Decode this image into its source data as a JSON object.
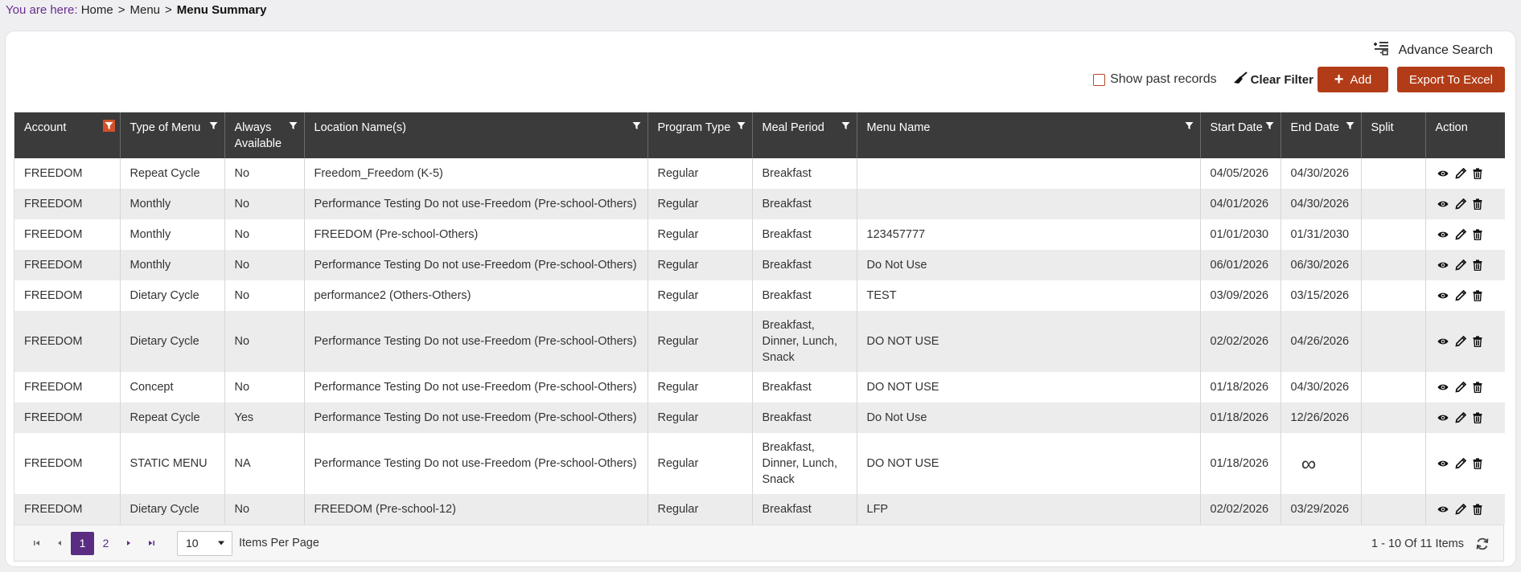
{
  "breadcrumb": {
    "prefix": "You are here:",
    "items": [
      "Home",
      "Menu"
    ],
    "separator": ">",
    "current": "Menu Summary"
  },
  "toolbar": {
    "advance_search": "Advance Search",
    "show_past_records": "Show past records",
    "show_past_checked": false,
    "clear_filter": "Clear Filter",
    "add": "Add",
    "export": "Export To Excel"
  },
  "colors": {
    "accent": "#b13c17",
    "header": "#3b3b3b",
    "pager_selected": "#5a2d82",
    "breadcrumb_prefix": "#6a2c8e"
  },
  "table": {
    "columns": [
      {
        "label": "Account",
        "filter": true,
        "filter_active": true
      },
      {
        "label": "Type of Menu",
        "filter": true
      },
      {
        "label": "Always Available",
        "filter": true
      },
      {
        "label": "Location Name(s)",
        "filter": true
      },
      {
        "label": "Program Type",
        "filter": true
      },
      {
        "label": "Meal Period",
        "filter": true
      },
      {
        "label": "Menu Name",
        "filter": true
      },
      {
        "label": "Start Date",
        "filter": true
      },
      {
        "label": "End Date",
        "filter": true
      },
      {
        "label": "Split",
        "filter": false
      },
      {
        "label": "Action",
        "filter": false
      }
    ],
    "rows": [
      [
        "FREEDOM",
        "Repeat Cycle",
        "No",
        "Freedom_Freedom (K-5)",
        "Regular",
        "Breakfast",
        "",
        "04/05/2026",
        "04/30/2026",
        ""
      ],
      [
        "FREEDOM",
        "Monthly",
        "No",
        "Performance Testing Do not use-Freedom (Pre-school-Others)",
        "Regular",
        "Breakfast",
        "",
        "04/01/2026",
        "04/30/2026",
        ""
      ],
      [
        "FREEDOM",
        "Monthly",
        "No",
        "FREEDOM (Pre-school-Others)",
        "Regular",
        "Breakfast",
        "123457777",
        "01/01/2030",
        "01/31/2030",
        ""
      ],
      [
        "FREEDOM",
        "Monthly",
        "No",
        "Performance Testing Do not use-Freedom (Pre-school-Others)",
        "Regular",
        "Breakfast",
        "Do Not Use",
        "06/01/2026",
        "06/30/2026",
        ""
      ],
      [
        "FREEDOM",
        "Dietary Cycle",
        "No",
        "performance2 (Others-Others)",
        "Regular",
        "Breakfast",
        "TEST",
        "03/09/2026",
        "03/15/2026",
        ""
      ],
      [
        "FREEDOM",
        "Dietary Cycle",
        "No",
        "Performance Testing Do not use-Freedom (Pre-school-Others)",
        "Regular",
        "Breakfast, Dinner, Lunch, Snack",
        "DO NOT USE",
        "02/02/2026",
        "04/26/2026",
        ""
      ],
      [
        "FREEDOM",
        "Concept",
        "No",
        "Performance Testing Do not use-Freedom (Pre-school-Others)",
        "Regular",
        "Breakfast",
        "DO NOT USE",
        "01/18/2026",
        "04/30/2026",
        ""
      ],
      [
        "FREEDOM",
        "Repeat Cycle",
        "Yes",
        "Performance Testing Do not use-Freedom (Pre-school-Others)",
        "Regular",
        "Breakfast",
        "Do Not Use",
        "01/18/2026",
        "12/26/2026",
        ""
      ],
      [
        "FREEDOM",
        "STATIC MENU",
        "NA",
        "Performance Testing Do not use-Freedom (Pre-school-Others)",
        "Regular",
        "Breakfast, Dinner, Lunch, Snack",
        "DO NOT USE",
        "01/18/2026",
        "∞",
        ""
      ],
      [
        "FREEDOM",
        "Dietary Cycle",
        "No",
        "FREEDOM (Pre-school-12)",
        "Regular",
        "Breakfast",
        "LFP",
        "02/02/2026",
        "03/29/2026",
        ""
      ]
    ],
    "row_actions": [
      "view-icon",
      "edit-icon",
      "delete-icon"
    ]
  },
  "pager": {
    "pages": [
      "1",
      "2"
    ],
    "current_page": "1",
    "page_size": "10",
    "items_per_page_label": "Items Per Page",
    "info": "1 - 10 Of 11 Items"
  }
}
